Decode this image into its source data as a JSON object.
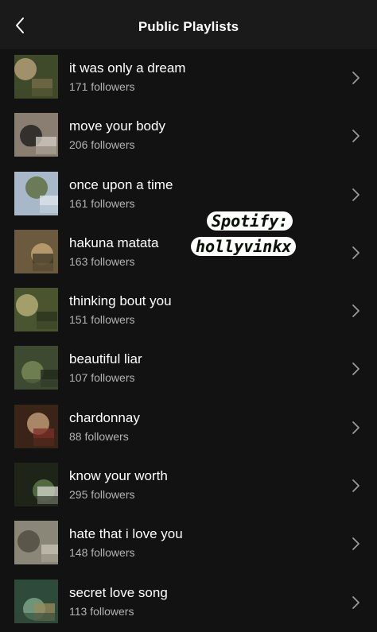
{
  "header": {
    "title": "Public Playlists",
    "back_icon": "chevron-left-icon"
  },
  "playlists": [
    {
      "name": "it was only a dream",
      "followers": "171 followers",
      "colors": [
        "#3f4a2a",
        "#b9a27a",
        "#7a6e4c"
      ]
    },
    {
      "name": "move your body",
      "followers": "206 followers",
      "colors": [
        "#8a7e72",
        "#1d1d1d",
        "#d6d0c7"
      ]
    },
    {
      "name": "once upon a time",
      "followers": "161 followers",
      "colors": [
        "#a9b8c8",
        "#5b6b3b",
        "#e2e7ee"
      ]
    },
    {
      "name": "hakuna matata",
      "followers": "163 followers",
      "colors": [
        "#6b5a3d",
        "#c8a874",
        "#3a3324"
      ]
    },
    {
      "name": "thinking bout you",
      "followers": "151 followers",
      "colors": [
        "#4a5530",
        "#b8b17a",
        "#2a301c"
      ]
    },
    {
      "name": "beautiful liar",
      "followers": "107 followers",
      "colors": [
        "#3d4a30",
        "#7c8b5a",
        "#1f2518"
      ]
    },
    {
      "name": "chardonnay",
      "followers": "88 followers",
      "colors": [
        "#3a2418",
        "#c6a07a",
        "#7a2e26"
      ]
    },
    {
      "name": "know your worth",
      "followers": "295 followers",
      "colors": [
        "#1e2418",
        "#5d7a4a",
        "#d8d8d0"
      ]
    },
    {
      "name": "hate that i love you",
      "followers": "148 followers",
      "colors": [
        "#8a8778",
        "#4d4a3e",
        "#c9c4b4"
      ]
    },
    {
      "name": "secret love song",
      "followers": "113 followers",
      "colors": [
        "#2e4a3a",
        "#7ea68a",
        "#9c8a5a"
      ]
    }
  ],
  "row_icon": "chevron-right-icon",
  "watermark": {
    "line1": "Spotify:",
    "line2": "hollyvinkx"
  }
}
